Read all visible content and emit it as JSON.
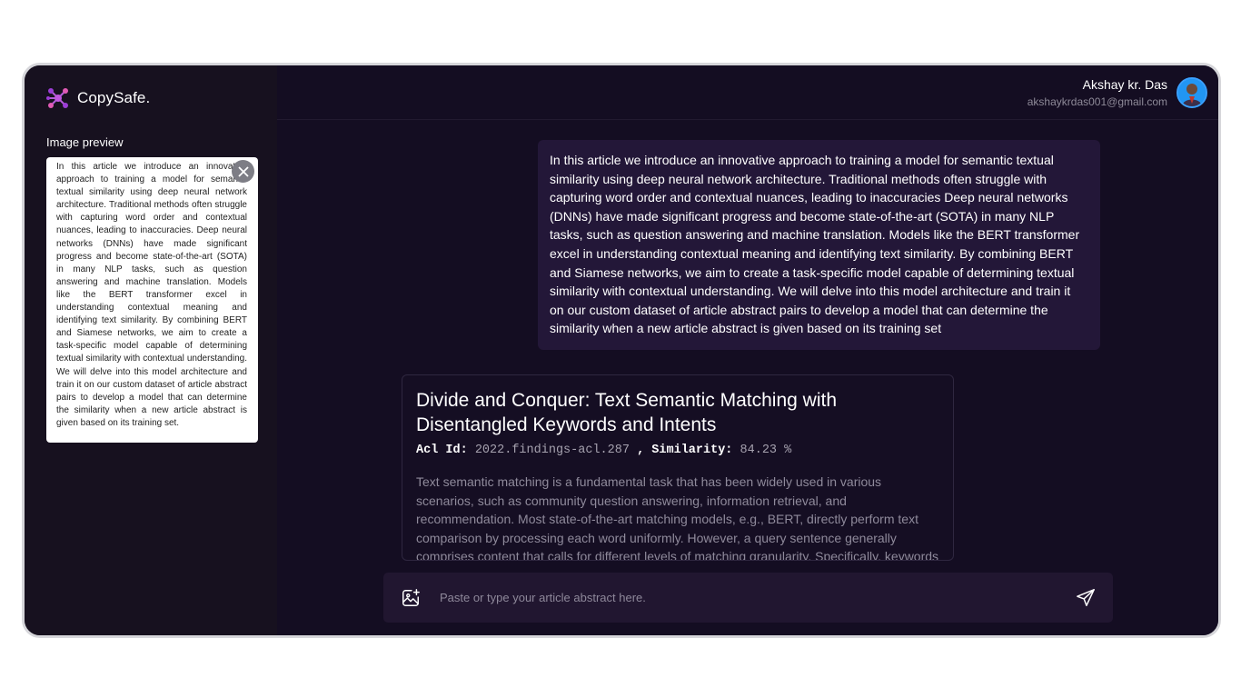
{
  "brand": {
    "name": "CopySafe.",
    "logo_icon": "molecule-icon",
    "accent": "#9b3dd6"
  },
  "sidebar": {
    "preview_label": "Image preview",
    "preview_text": "In this article we introduce an innovative approach to training a model for semantic textual similarity using deep neural network architecture. Traditional methods often struggle with capturing word order and contextual nuances, leading to inaccuracies. Deep neural networks (DNNs) have made significant progress and become state-of-the-art (SOTA) in many NLP tasks, such as question answering and machine translation. Models like the BERT transformer excel in understanding contextual meaning and identifying text similarity. By combining BERT and Siamese networks, we aim to create a task-specific model capable of determining textual similarity with contextual understanding. We will delve into this model architecture and train it on our custom dataset of article abstract pairs to develop a model that can determine the similarity when a new article abstract is given based on its training set.",
    "close_icon": "close-icon"
  },
  "user": {
    "name": "Akshay kr. Das",
    "email": "akshaykrdas001@gmail.com"
  },
  "message": {
    "text": "In this article we introduce an innovative approach to training a model for semantic textual similarity using deep neural network architecture. Traditional methods often struggle with capturing word order and contextual nuances, leading to inaccuracies Deep neural networks (DNNs) have made significant progress and become state-of-the-art (SOTA) in many NLP tasks, such as question answering and machine translation. Models like the BERT transformer excel in understanding contextual meaning and identifying text similarity. By combining BERT and Siamese networks, we aim to create a task-specific model capable of determining textual similarity with contextual understanding. We will delve into this model architecture and train it on our custom dataset of article abstract pairs to develop a model that can determine the similarity when a new article abstract is given based on its training set"
  },
  "result": {
    "title": "Divide and Conquer: Text Semantic Matching with Disentangled Keywords and Intents",
    "acl_id_label": "Acl Id:",
    "acl_id": "2022.findings-acl.287",
    "separator": ",",
    "similarity_label": "Similarity:",
    "similarity": "84.23 %",
    "abstract": "Text semantic matching is a fundamental task that has been widely used in various scenarios, such as community question answering, information retrieval, and recommendation. Most state-of-the-art matching models, e.g., BERT, directly perform text comparison by processing each word uniformly. However, a query sentence generally comprises content that calls for different levels of matching granularity. Specifically, keywords represent factual information"
  },
  "composer": {
    "placeholder": "Paste or type your article abstract here.",
    "attach_icon": "image-add-icon",
    "send_icon": "send-icon"
  }
}
